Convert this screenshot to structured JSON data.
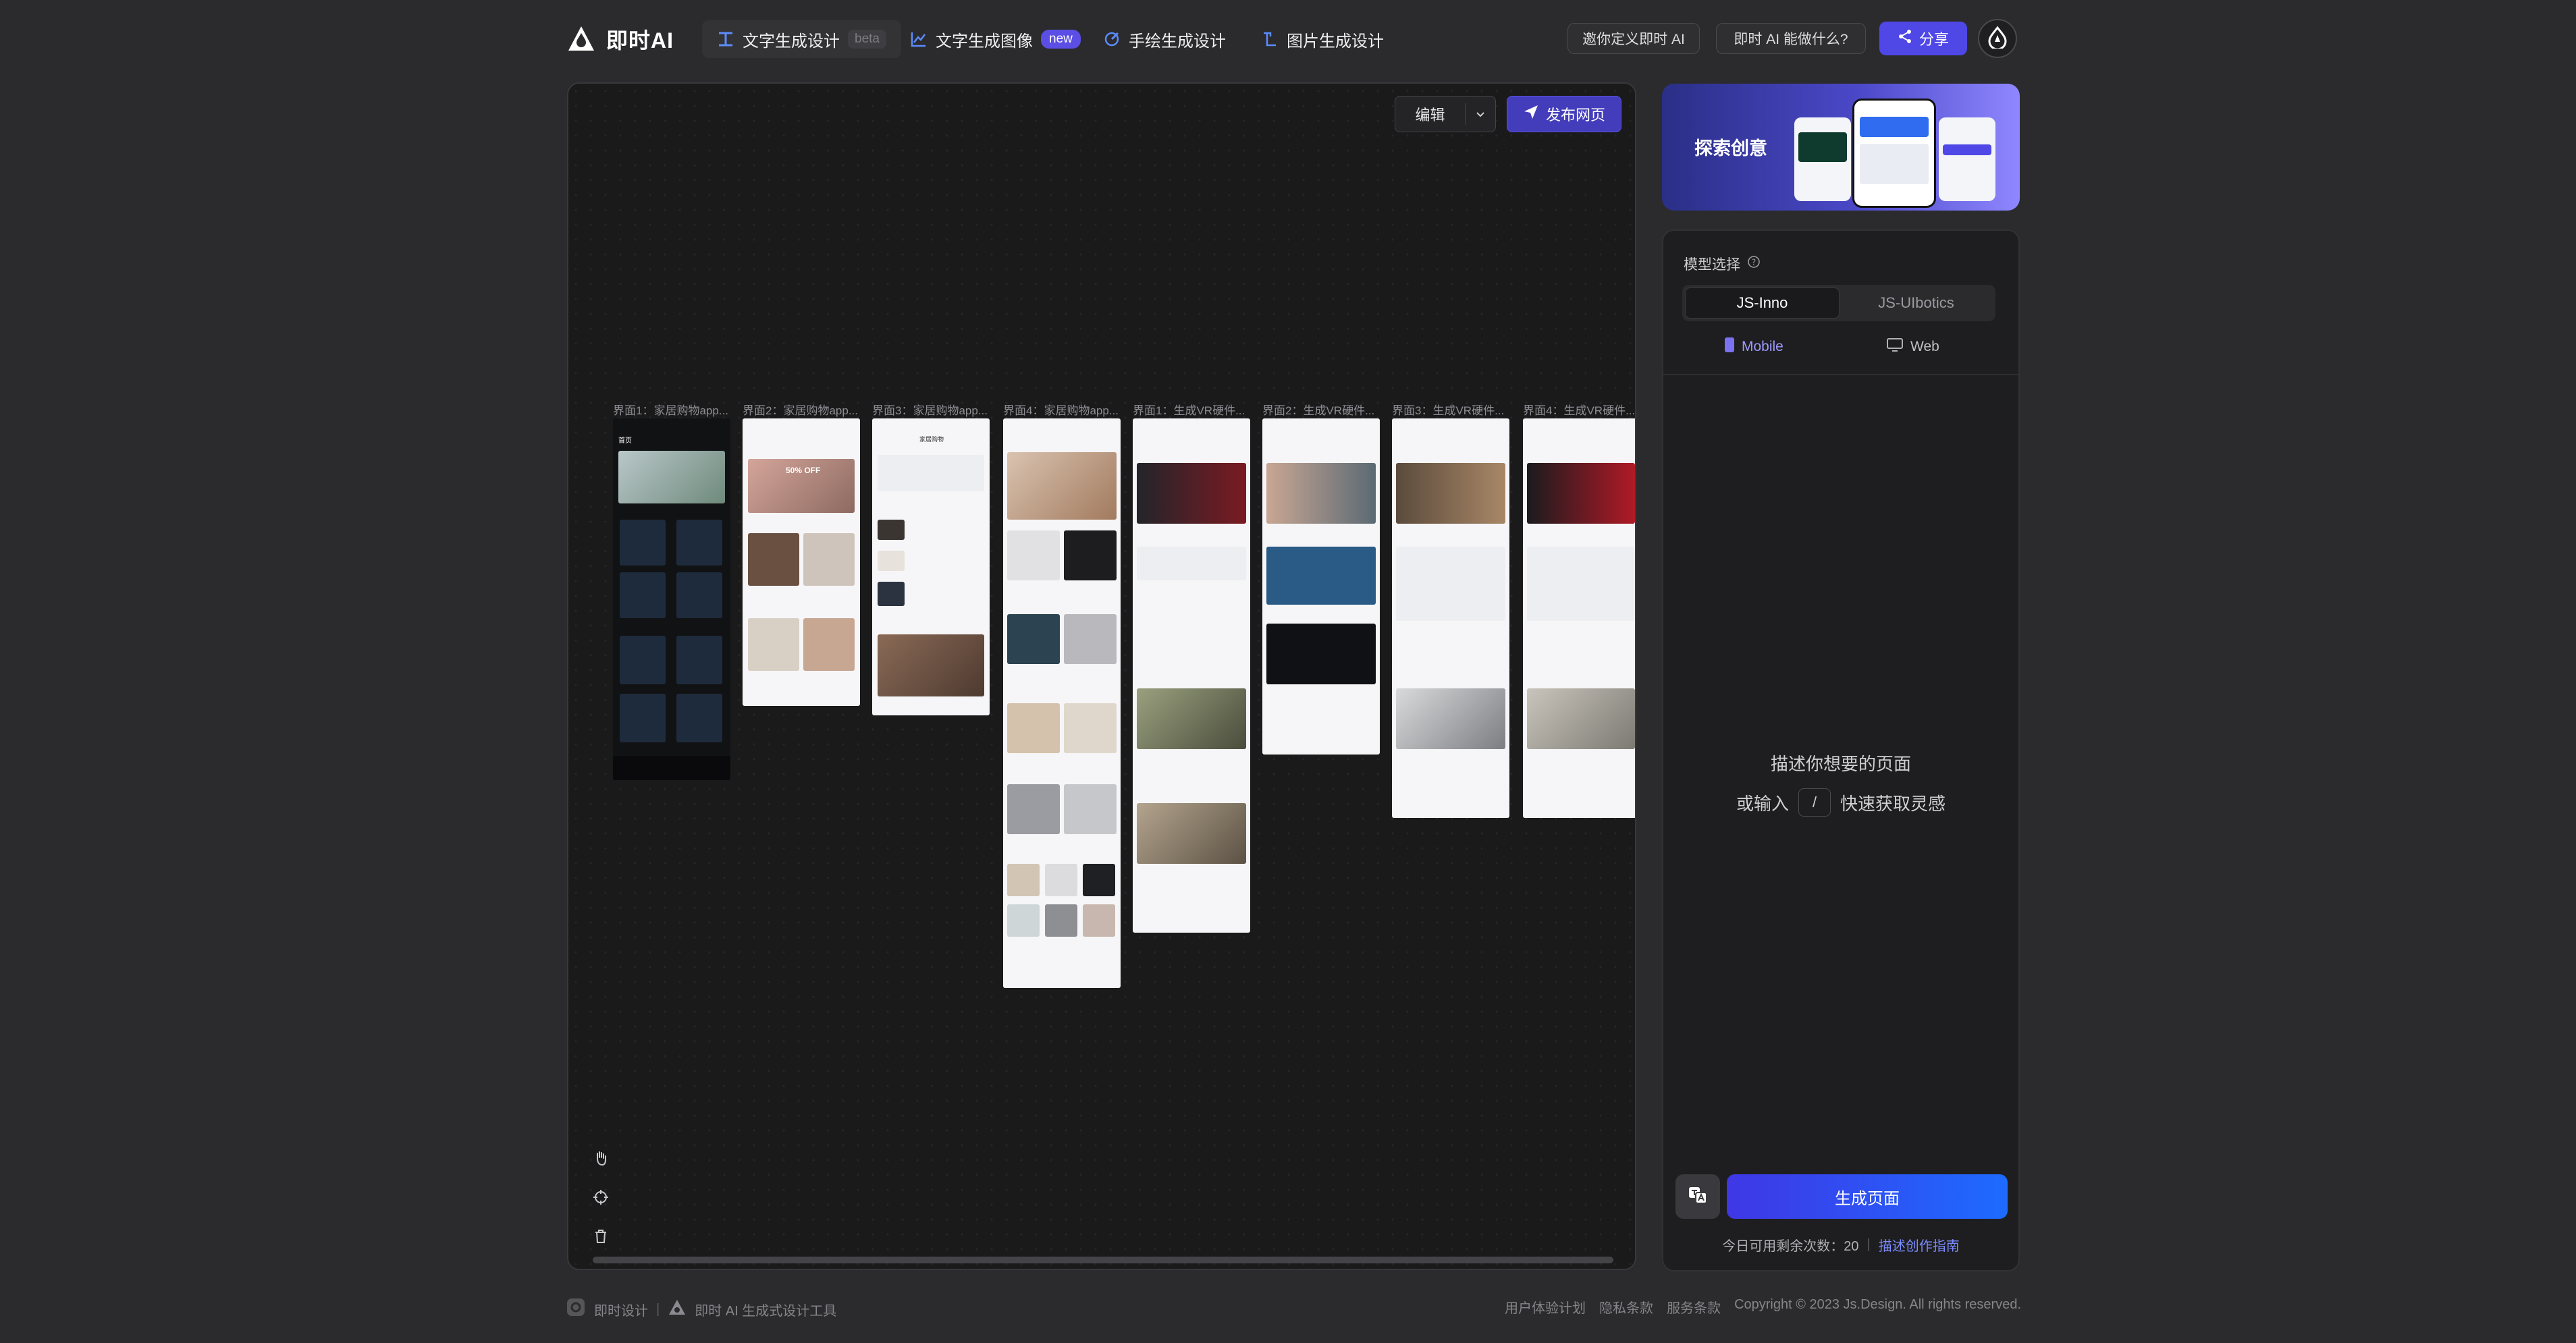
{
  "header": {
    "logo_text": "即时AI",
    "tabs": [
      {
        "label": "文字生成设计",
        "badge": "beta"
      },
      {
        "label": "文字生成图像",
        "badge": "new"
      },
      {
        "label": "手绘生成设计"
      },
      {
        "label": "图片生成设计"
      }
    ],
    "invite_label": "邀你定义即时 AI",
    "what_label": "即时 AI 能做什么?",
    "share_label": "分享"
  },
  "canvas": {
    "edit_label": "编辑",
    "publish_label": "发布网页",
    "frames": [
      {
        "label": "界面1：家居购物app..."
      },
      {
        "label": "界面2：家居购物app..."
      },
      {
        "label": "界面3：家居购物app..."
      },
      {
        "label": "界面4：家居购物app..."
      },
      {
        "label": "界面1：生成VR硬件..."
      },
      {
        "label": "界面2：生成VR硬件..."
      },
      {
        "label": "界面3：生成VR硬件..."
      },
      {
        "label": "界面4：生成VR硬件..."
      }
    ],
    "frame_texts": {
      "f1_title": "首页",
      "f2_sale": "50% OFF",
      "f3_title": "家居购物"
    }
  },
  "panel": {
    "banner_text": "探索创意",
    "model_title": "模型选择",
    "models": [
      "JS-Inno",
      "JS-UIbotics"
    ],
    "devices": [
      "Mobile",
      "Web"
    ],
    "hint_line1": "描述你想要的页面",
    "hint_prefix": "或输入",
    "hint_key": "/",
    "hint_suffix": "快速获取灵感",
    "generate_label": "生成页面",
    "quota_text": "今日可用剩余次数：20",
    "guide_link": "描述创作指南"
  },
  "footer": {
    "brand1": "即时设计",
    "brand2": "即时 AI 生成式设计工具",
    "links": [
      "用户体验计划",
      "隐私条款",
      "服务条款",
      "Copyright © 2023 Js.Design. All rights reserved."
    ]
  },
  "colors": {
    "accent": "#4f47e6",
    "background": "#2b2b2d",
    "canvas": "#1a1a1b"
  }
}
